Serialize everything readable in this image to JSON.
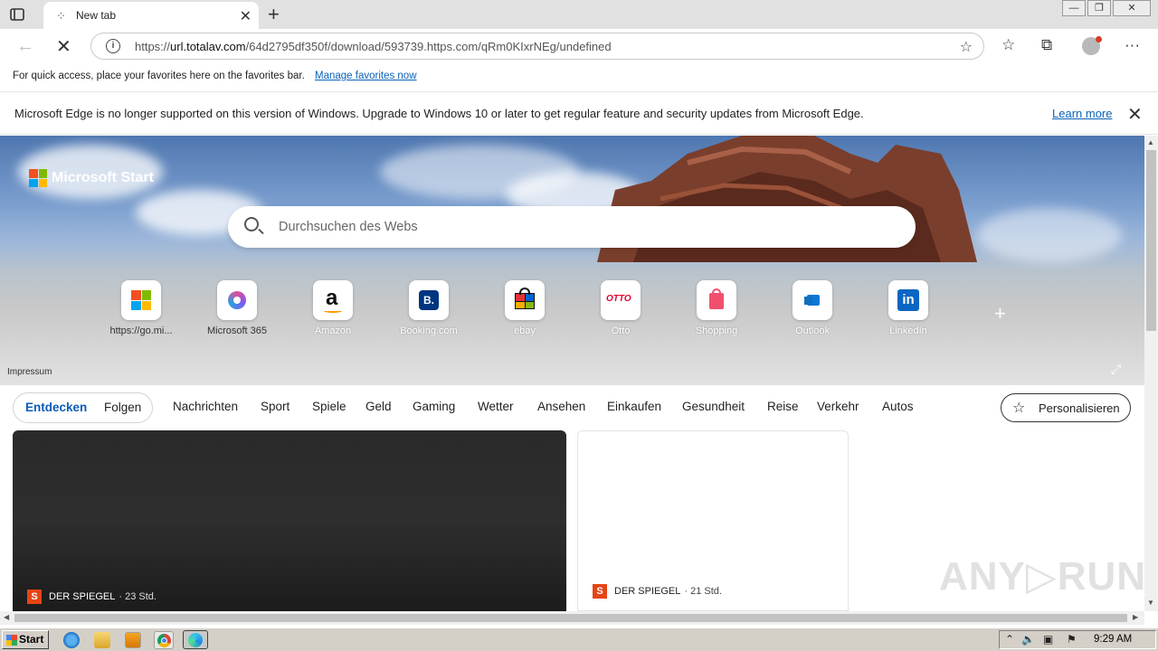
{
  "tab": {
    "title": "New tab",
    "close": "✕",
    "new": "+"
  },
  "window": {
    "min": "—",
    "max": "❐",
    "close": "✕"
  },
  "address": {
    "url_prefix": "https://",
    "url_host": "url.totalav.com",
    "url_path": "/64d2795df350f/download/593739.https.com/qRm0KIxrNEg/undefined"
  },
  "favbar": {
    "text": "For quick access, place your favorites here on the favorites bar.",
    "link": "Manage favorites now"
  },
  "infobar": {
    "message": "Microsoft Edge is no longer supported on this version of Windows. Upgrade to Windows 10 or later to get regular feature and security updates from Microsoft Edge.",
    "learn_more": "Learn more"
  },
  "start": {
    "brand": "Microsoft Start",
    "search_placeholder": "Durchsuchen des Webs",
    "impressum": "Impressum",
    "quicklinks": [
      {
        "label": "https://go.mi...",
        "icon": "microsoft-icon"
      },
      {
        "label": "Microsoft 365",
        "icon": "microsoft365-icon"
      },
      {
        "label": "Amazon",
        "icon": "amazon-icon",
        "glyph": "a"
      },
      {
        "label": "Booking.com",
        "icon": "booking-icon",
        "glyph": "B."
      },
      {
        "label": "ebay",
        "icon": "ebay-icon"
      },
      {
        "label": "Otto",
        "icon": "otto-icon",
        "glyph": "OTTO"
      },
      {
        "label": "Shopping",
        "icon": "shopping-icon"
      },
      {
        "label": "Outlook",
        "icon": "outlook-icon"
      },
      {
        "label": "LinkedIn",
        "icon": "linkedin-icon",
        "glyph": "in"
      }
    ]
  },
  "feed": {
    "pill_active": "Entdecken",
    "pill_other": "Folgen",
    "categories": [
      "Nachrichten",
      "Sport",
      "Spiele",
      "Geld",
      "Gaming",
      "Wetter",
      "Ansehen",
      "Einkaufen",
      "Gesundheit",
      "Reise",
      "Verkehr",
      "Autos"
    ],
    "personalize": "Personalisieren",
    "card1": {
      "source": "DER SPIEGEL",
      "age": "· 23 Std.",
      "logo": "S"
    },
    "card2": {
      "source": "DER SPIEGEL",
      "age": "· 21 Std.",
      "logo": "S"
    }
  },
  "watermark": "ANY▷RUN",
  "taskbar": {
    "start": "Start",
    "clock": "9:29 AM"
  },
  "colors": {
    "accent": "#0a5cb8",
    "spiegel": "#e64415",
    "taskbar": "#d4d0c8"
  }
}
